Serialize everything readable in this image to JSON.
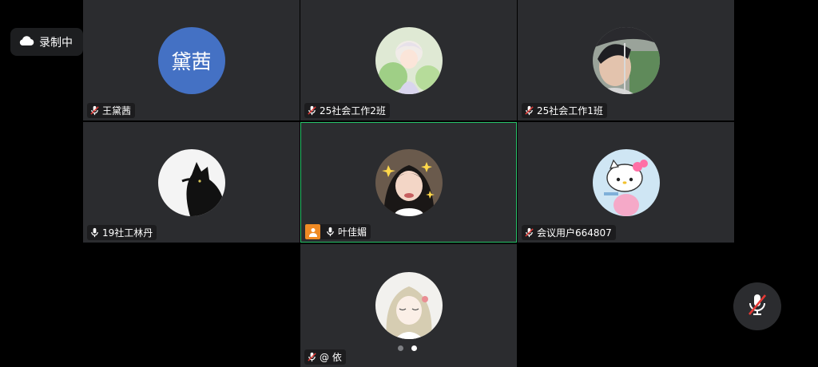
{
  "recording": {
    "icon": "cloud-icon",
    "label": "录制中"
  },
  "participants": [
    {
      "name": "王黛茜",
      "avatar_text": "黛茜",
      "mic": "muted"
    },
    {
      "name": "25社会工作2班",
      "mic": "muted"
    },
    {
      "name": "25社会工作1班",
      "mic": "muted"
    },
    {
      "name": "19社工林丹",
      "mic": "on"
    },
    {
      "name": "叶佳媚",
      "mic": "on",
      "host": true,
      "active_speaker": true
    },
    {
      "name": "会议用户664807",
      "mic": "muted"
    },
    {
      "name": "@ 依",
      "mic": "muted"
    }
  ],
  "pagination": {
    "pages": 2,
    "current": 2
  },
  "controls": {
    "mute_button_icon": "mic-muted-icon"
  },
  "colors": {
    "tile": "#2b2c2f",
    "active_border": "#27c36a",
    "host_badge": "#ef8a24",
    "avatar_blue": "#4471c4",
    "mute_red": "#e53935"
  }
}
